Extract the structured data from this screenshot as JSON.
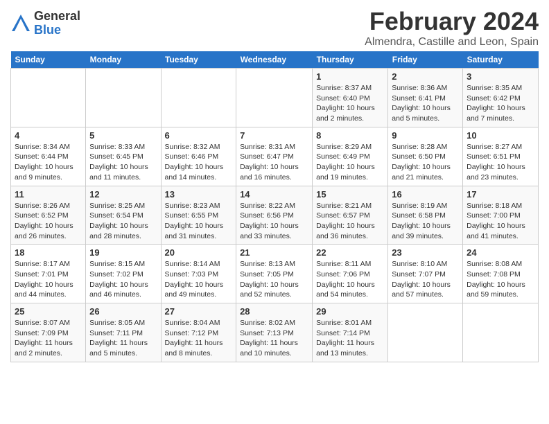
{
  "logo": {
    "general": "General",
    "blue": "Blue"
  },
  "title": "February 2024",
  "subtitle": "Almendra, Castille and Leon, Spain",
  "days_header": [
    "Sunday",
    "Monday",
    "Tuesday",
    "Wednesday",
    "Thursday",
    "Friday",
    "Saturday"
  ],
  "weeks": [
    [
      {
        "day": "",
        "info": ""
      },
      {
        "day": "",
        "info": ""
      },
      {
        "day": "",
        "info": ""
      },
      {
        "day": "",
        "info": ""
      },
      {
        "day": "1",
        "info": "Sunrise: 8:37 AM\nSunset: 6:40 PM\nDaylight: 10 hours\nand 2 minutes."
      },
      {
        "day": "2",
        "info": "Sunrise: 8:36 AM\nSunset: 6:41 PM\nDaylight: 10 hours\nand 5 minutes."
      },
      {
        "day": "3",
        "info": "Sunrise: 8:35 AM\nSunset: 6:42 PM\nDaylight: 10 hours\nand 7 minutes."
      }
    ],
    [
      {
        "day": "4",
        "info": "Sunrise: 8:34 AM\nSunset: 6:44 PM\nDaylight: 10 hours\nand 9 minutes."
      },
      {
        "day": "5",
        "info": "Sunrise: 8:33 AM\nSunset: 6:45 PM\nDaylight: 10 hours\nand 11 minutes."
      },
      {
        "day": "6",
        "info": "Sunrise: 8:32 AM\nSunset: 6:46 PM\nDaylight: 10 hours\nand 14 minutes."
      },
      {
        "day": "7",
        "info": "Sunrise: 8:31 AM\nSunset: 6:47 PM\nDaylight: 10 hours\nand 16 minutes."
      },
      {
        "day": "8",
        "info": "Sunrise: 8:29 AM\nSunset: 6:49 PM\nDaylight: 10 hours\nand 19 minutes."
      },
      {
        "day": "9",
        "info": "Sunrise: 8:28 AM\nSunset: 6:50 PM\nDaylight: 10 hours\nand 21 minutes."
      },
      {
        "day": "10",
        "info": "Sunrise: 8:27 AM\nSunset: 6:51 PM\nDaylight: 10 hours\nand 23 minutes."
      }
    ],
    [
      {
        "day": "11",
        "info": "Sunrise: 8:26 AM\nSunset: 6:52 PM\nDaylight: 10 hours\nand 26 minutes."
      },
      {
        "day": "12",
        "info": "Sunrise: 8:25 AM\nSunset: 6:54 PM\nDaylight: 10 hours\nand 28 minutes."
      },
      {
        "day": "13",
        "info": "Sunrise: 8:23 AM\nSunset: 6:55 PM\nDaylight: 10 hours\nand 31 minutes."
      },
      {
        "day": "14",
        "info": "Sunrise: 8:22 AM\nSunset: 6:56 PM\nDaylight: 10 hours\nand 33 minutes."
      },
      {
        "day": "15",
        "info": "Sunrise: 8:21 AM\nSunset: 6:57 PM\nDaylight: 10 hours\nand 36 minutes."
      },
      {
        "day": "16",
        "info": "Sunrise: 8:19 AM\nSunset: 6:58 PM\nDaylight: 10 hours\nand 39 minutes."
      },
      {
        "day": "17",
        "info": "Sunrise: 8:18 AM\nSunset: 7:00 PM\nDaylight: 10 hours\nand 41 minutes."
      }
    ],
    [
      {
        "day": "18",
        "info": "Sunrise: 8:17 AM\nSunset: 7:01 PM\nDaylight: 10 hours\nand 44 minutes."
      },
      {
        "day": "19",
        "info": "Sunrise: 8:15 AM\nSunset: 7:02 PM\nDaylight: 10 hours\nand 46 minutes."
      },
      {
        "day": "20",
        "info": "Sunrise: 8:14 AM\nSunset: 7:03 PM\nDaylight: 10 hours\nand 49 minutes."
      },
      {
        "day": "21",
        "info": "Sunrise: 8:13 AM\nSunset: 7:05 PM\nDaylight: 10 hours\nand 52 minutes."
      },
      {
        "day": "22",
        "info": "Sunrise: 8:11 AM\nSunset: 7:06 PM\nDaylight: 10 hours\nand 54 minutes."
      },
      {
        "day": "23",
        "info": "Sunrise: 8:10 AM\nSunset: 7:07 PM\nDaylight: 10 hours\nand 57 minutes."
      },
      {
        "day": "24",
        "info": "Sunrise: 8:08 AM\nSunset: 7:08 PM\nDaylight: 10 hours\nand 59 minutes."
      }
    ],
    [
      {
        "day": "25",
        "info": "Sunrise: 8:07 AM\nSunset: 7:09 PM\nDaylight: 11 hours\nand 2 minutes."
      },
      {
        "day": "26",
        "info": "Sunrise: 8:05 AM\nSunset: 7:11 PM\nDaylight: 11 hours\nand 5 minutes."
      },
      {
        "day": "27",
        "info": "Sunrise: 8:04 AM\nSunset: 7:12 PM\nDaylight: 11 hours\nand 8 minutes."
      },
      {
        "day": "28",
        "info": "Sunrise: 8:02 AM\nSunset: 7:13 PM\nDaylight: 11 hours\nand 10 minutes."
      },
      {
        "day": "29",
        "info": "Sunrise: 8:01 AM\nSunset: 7:14 PM\nDaylight: 11 hours\nand 13 minutes."
      },
      {
        "day": "",
        "info": ""
      },
      {
        "day": "",
        "info": ""
      }
    ]
  ]
}
